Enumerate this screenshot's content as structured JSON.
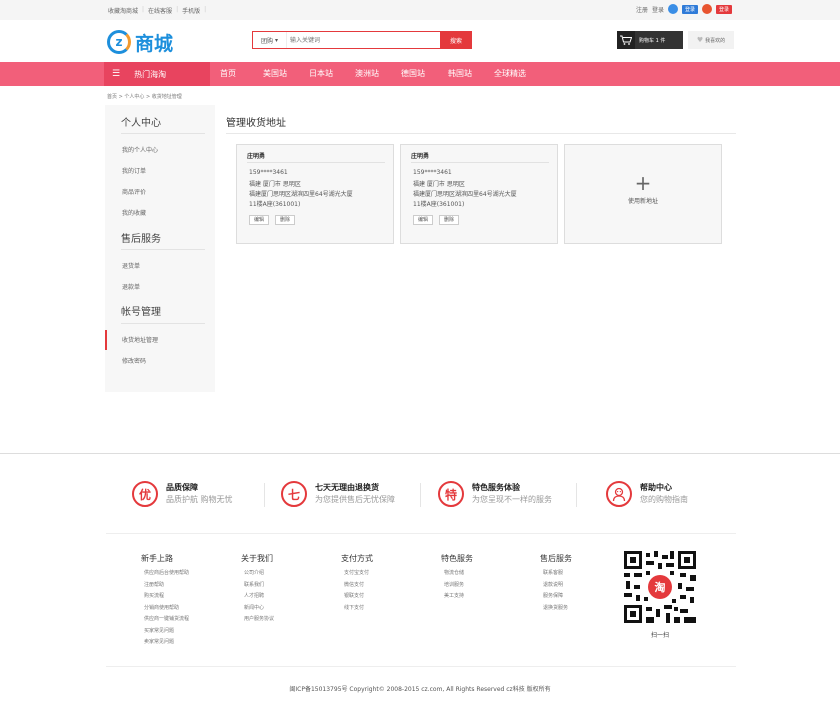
{
  "topbar": {
    "links": [
      "收藏淘商城",
      "在线客服",
      "手机版"
    ],
    "register": "注册",
    "login": "登录",
    "qq_login": "登录",
    "weibo_login": "登录"
  },
  "header": {
    "logo_mark": "z",
    "logo_text": "商城",
    "search_type": "团购",
    "search_placeholder": "输入关键词",
    "search_button": "搜索",
    "cart_label": "购物车 1 件",
    "favorites_label": "我喜欢的"
  },
  "nav": {
    "category": "热门海淘",
    "items": [
      "首页",
      "美国站",
      "日本站",
      "澳洲站",
      "德国站",
      "韩国站",
      "全球精选"
    ]
  },
  "breadcrumb": "首页 > 个人中心 > 收货地址管理",
  "sidebar": {
    "sections": [
      {
        "title": "个人中心",
        "items": [
          "我的个人中心",
          "我的订单",
          "商品评价",
          "我的收藏"
        ]
      },
      {
        "title": "售后服务",
        "items": [
          "退货单",
          "退款单"
        ]
      },
      {
        "title": "帐号管理",
        "items": [
          "收货地址管理",
          "修改密码"
        ]
      }
    ]
  },
  "main": {
    "title": "管理收货地址",
    "addresses": [
      {
        "name": "庄明勇",
        "phone": "159****3461",
        "region": "福建 厦门市 思明区",
        "street": "福建厦门思明区湖滨四里64号湖光大厦",
        "detail": "11楼A座(361001)",
        "edit": "编辑",
        "delete": "删除"
      },
      {
        "name": "庄明勇",
        "phone": "159****3461",
        "region": "福建 厦门市 思明区",
        "street": "福建厦门思明区湖滨四里64号湖光大厦",
        "detail": "11楼A座(361001)",
        "edit": "编辑",
        "delete": "删除"
      }
    ],
    "new_address_plus": "+",
    "new_address_label": "使用新地址"
  },
  "footer": {
    "services": [
      {
        "icon": "优",
        "title": "品质保障",
        "sub": "品质护航 购物无忧"
      },
      {
        "icon": "七",
        "title": "七天无理由退换货",
        "sub": "为您提供售后无忧保障"
      },
      {
        "icon": "特",
        "title": "特色服务体验",
        "sub": "为您呈现不一样的服务"
      },
      {
        "icon": "",
        "title": "帮助中心",
        "sub": "您的购物指南"
      }
    ],
    "columns": [
      {
        "title": "新手上路",
        "items": [
          "供应商后台使用帮助",
          "注册帮助",
          "购买流程",
          "分销商使用帮助",
          "供应商一键铺货流程",
          "买家常见问题",
          "卖家常见问题"
        ]
      },
      {
        "title": "关于我们",
        "items": [
          "公司介绍",
          "联系我们",
          "人才招聘",
          "新闻中心",
          "用户服务协议"
        ]
      },
      {
        "title": "支付方式",
        "items": [
          "支付宝支付",
          "微信支付",
          "银联支付",
          "线下支付"
        ]
      },
      {
        "title": "特色服务",
        "items": [
          "物流仓储",
          "培训服务",
          "美工支持"
        ]
      },
      {
        "title": "售后服务",
        "items": [
          "联系客服",
          "退款说明",
          "服务保障",
          "退换货服务"
        ]
      }
    ],
    "qr_center": "淘",
    "qr_label": "扫一扫",
    "copyright": "闽ICP备15013795号 Copyright© 2008-2015 cz.com, All Rights Reserved cz科技 版权所有"
  },
  "colors": {
    "brand_red": "#e4393c",
    "nav_pink": "#f25f7a",
    "logo_blue": "#1d8fdc"
  }
}
